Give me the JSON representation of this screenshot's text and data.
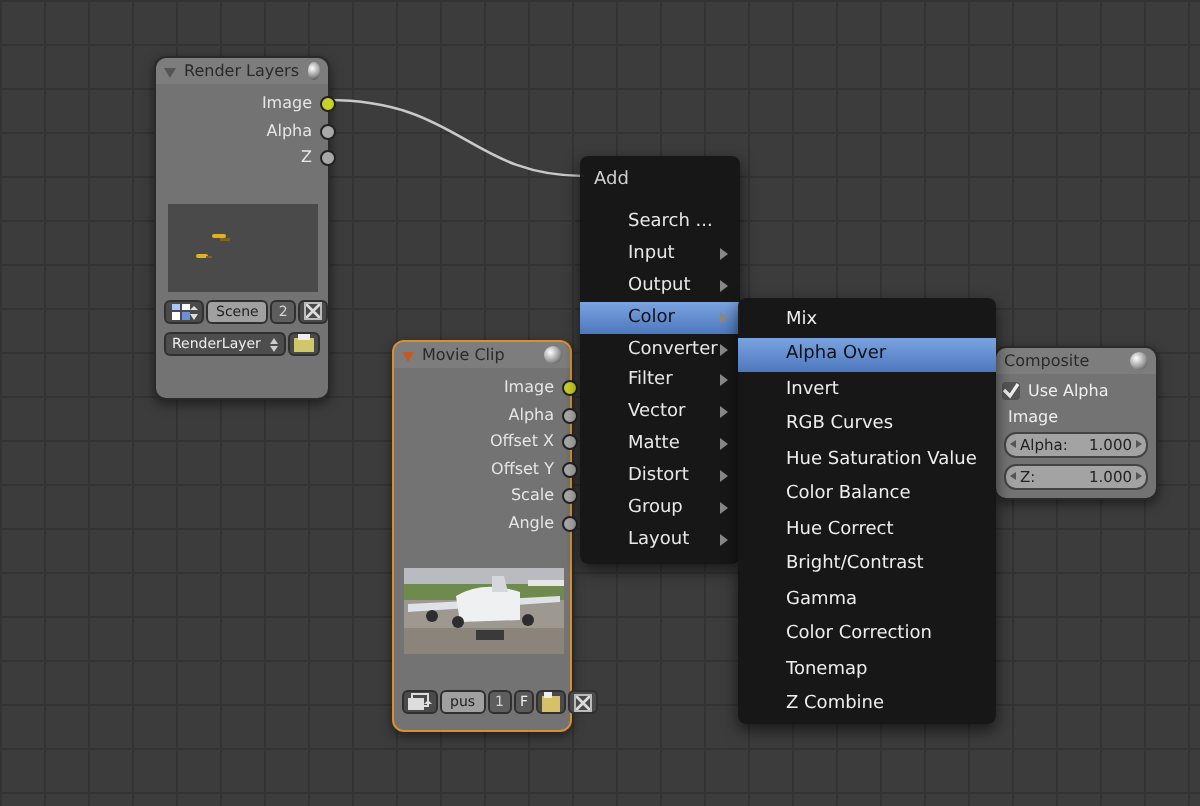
{
  "render_layers": {
    "title": "Render Layers",
    "selected": false,
    "outputs": [
      {
        "label": "Image",
        "color": "#c8d02a"
      },
      {
        "label": "Alpha",
        "color": "#a8a8a8"
      },
      {
        "label": "Z",
        "color": "#a8a8a8"
      }
    ],
    "scene": "Scene",
    "layer_number": "2",
    "layer": "RenderLayer"
  },
  "movie_clip": {
    "title": "Movie Clip",
    "selected": true,
    "outputs": [
      {
        "label": "Image",
        "color": "#c8d02a"
      },
      {
        "label": "Alpha",
        "color": "#a8a8a8"
      },
      {
        "label": "Offset X",
        "color": "#a8a8a8"
      },
      {
        "label": "Offset Y",
        "color": "#a8a8a8"
      },
      {
        "label": "Scale",
        "color": "#a8a8a8"
      },
      {
        "label": "Angle",
        "color": "#a8a8a8"
      }
    ],
    "clip": "pus",
    "users": "1",
    "fake_user": "F"
  },
  "add_menu": {
    "title": "Add",
    "items": [
      {
        "label": "Search ...",
        "submenu": false,
        "selected": false
      },
      {
        "label": "Input",
        "submenu": true,
        "selected": false
      },
      {
        "label": "Output",
        "submenu": true,
        "selected": false
      },
      {
        "label": "Color",
        "submenu": true,
        "selected": true
      },
      {
        "label": "Converter",
        "submenu": true,
        "selected": false
      },
      {
        "label": "Filter",
        "submenu": true,
        "selected": false
      },
      {
        "label": "Vector",
        "submenu": true,
        "selected": false
      },
      {
        "label": "Matte",
        "submenu": true,
        "selected": false
      },
      {
        "label": "Distort",
        "submenu": true,
        "selected": false
      },
      {
        "label": "Group",
        "submenu": true,
        "selected": false
      },
      {
        "label": "Layout",
        "submenu": true,
        "selected": false
      }
    ]
  },
  "color_menu": {
    "items": [
      {
        "label": "Mix",
        "selected": false
      },
      {
        "label": "Alpha Over",
        "selected": true
      },
      {
        "label": "Invert",
        "selected": false
      },
      {
        "label": "RGB Curves",
        "selected": false
      },
      {
        "label": "Hue Saturation Value",
        "selected": false
      },
      {
        "label": "Color Balance",
        "selected": false
      },
      {
        "label": "Hue Correct",
        "selected": false
      },
      {
        "label": "Bright/Contrast",
        "selected": false
      },
      {
        "label": "Gamma",
        "selected": false
      },
      {
        "label": "Color Correction",
        "selected": false
      },
      {
        "label": "Tonemap",
        "selected": false
      },
      {
        "label": "Z Combine",
        "selected": false
      }
    ]
  },
  "composite": {
    "title": "Composite",
    "selected": false,
    "use_alpha_label": "Use Alpha",
    "use_alpha": true,
    "input_label": "Image",
    "fields": [
      {
        "label": "Alpha:",
        "value": "1.000"
      },
      {
        "label": "Z:",
        "value": "1.000"
      }
    ]
  }
}
